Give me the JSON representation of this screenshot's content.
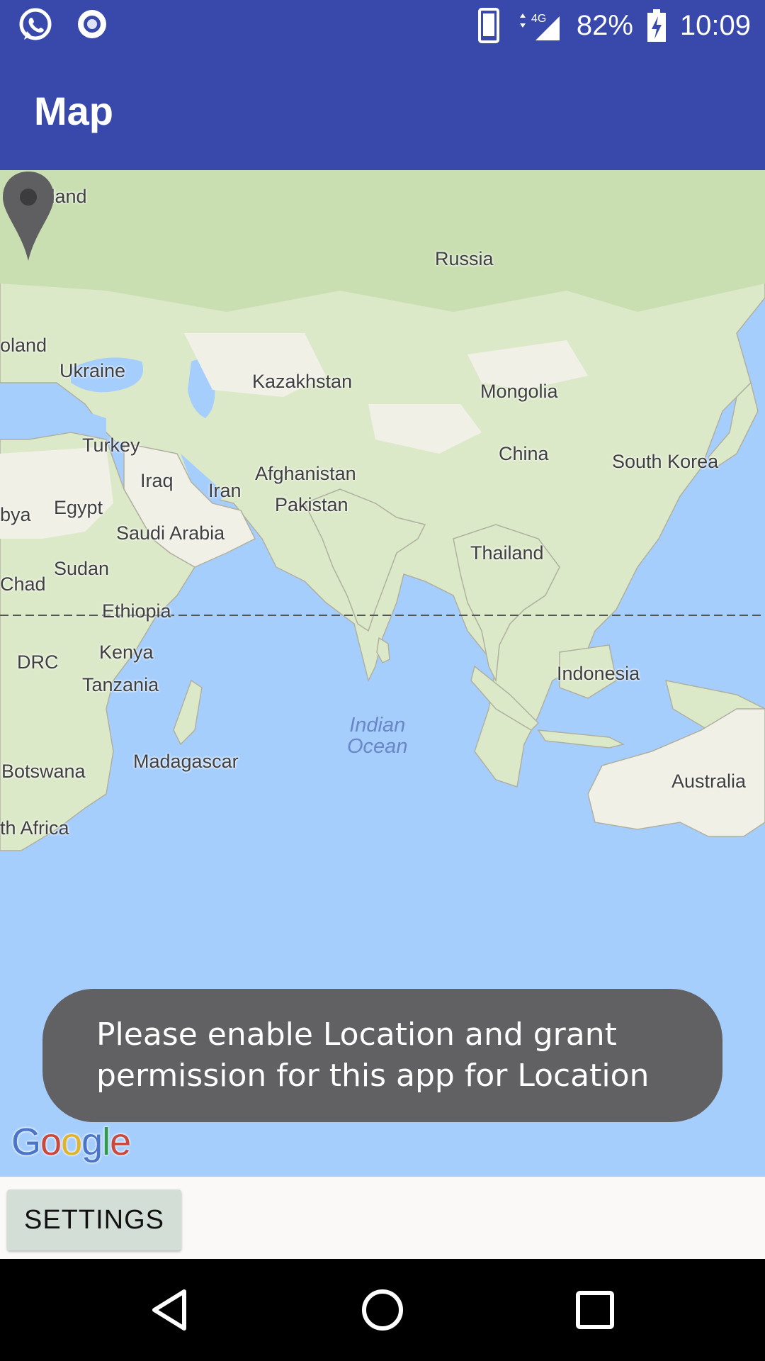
{
  "status_bar": {
    "left_icons": [
      "whatsapp-icon",
      "camera-icon"
    ],
    "network": "4G",
    "battery": "82%",
    "time": "10:09"
  },
  "app_bar": {
    "title": "Map"
  },
  "map": {
    "labels": {
      "finland": "Finland",
      "russia": "Russia",
      "poland": "oland",
      "ukraine": "Ukraine",
      "kazakhstan": "Kazakhstan",
      "mongolia": "Mongolia",
      "turkey": "Turkey",
      "china": "China",
      "south_korea": "South Korea",
      "iraq": "Iraq",
      "afghanistan": "Afghanistan",
      "iran": "Iran",
      "libya": "bya",
      "egypt": "Egypt",
      "pakistan": "Pakistan",
      "saudi_arabia": "Saudi Arabia",
      "thailand": "Thailand",
      "sudan": "Sudan",
      "chad": "Chad",
      "ethiopia": "Ethiopia",
      "kenya": "Kenya",
      "drc": "DRC",
      "indonesia": "Indonesia",
      "tanzania": "Tanzania",
      "madagascar": "Madagascar",
      "indian_ocean_line1": "Indian",
      "indian_ocean_line2": "Ocean",
      "botswana": "Botswana",
      "australia": "Australia",
      "south_africa": "th Africa"
    },
    "marker": "map-pin-icon",
    "attribution": [
      "G",
      "o",
      "o",
      "g",
      "l",
      "e"
    ]
  },
  "toast": {
    "line1": "Please enable Location and grant",
    "line2": "permission for this app for Location"
  },
  "bottom_panel": {
    "settings_label": "SETTINGS"
  },
  "nav_bar": {
    "buttons": [
      "back-icon",
      "home-icon",
      "recents-icon"
    ]
  }
}
